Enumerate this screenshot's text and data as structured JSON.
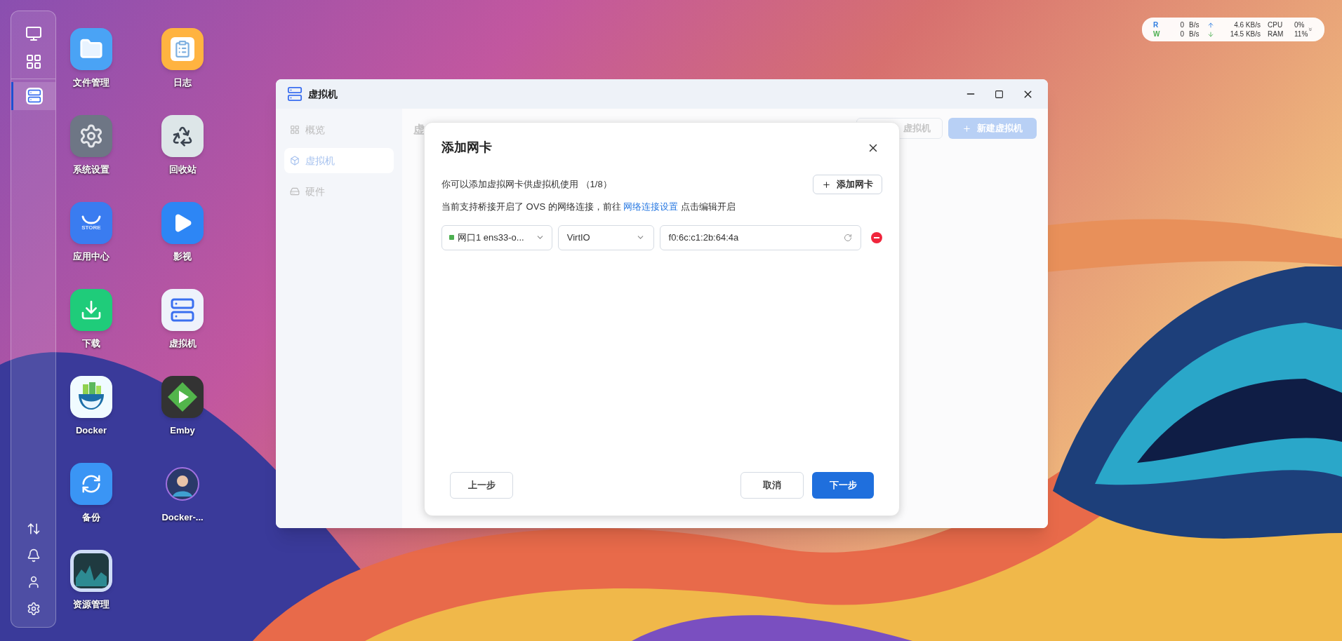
{
  "dock": {
    "apps": [
      {
        "kind": "monitor",
        "selected": false
      },
      {
        "kind": "apps",
        "selected": false
      },
      {
        "kind": "vm",
        "selected": true
      }
    ],
    "tools": [
      {
        "kind": "transfer"
      },
      {
        "kind": "bell"
      },
      {
        "kind": "user"
      },
      {
        "kind": "gear"
      }
    ]
  },
  "desktop_icons": [
    {
      "label": "文件管理",
      "kind": "files"
    },
    {
      "label": "日志",
      "kind": "notes"
    },
    {
      "label": "系统设置",
      "kind": "settings"
    },
    {
      "label": "回收站",
      "kind": "recycle"
    },
    {
      "label": "应用中心",
      "kind": "store",
      "icon_text": "STORE"
    },
    {
      "label": "影视",
      "kind": "video"
    },
    {
      "label": "下载",
      "kind": "download"
    },
    {
      "label": "虚拟机",
      "kind": "vm"
    },
    {
      "label": "Docker",
      "kind": "docker"
    },
    {
      "label": "Emby",
      "kind": "emby"
    },
    {
      "label": "备份",
      "kind": "backup"
    },
    {
      "label": "Docker-...",
      "kind": "avatar"
    },
    {
      "label": "资源管理",
      "kind": "monitor"
    }
  ],
  "status_widget": {
    "rows": [
      {
        "letter": "R",
        "color": "#2f7de1",
        "disk": "0",
        "disk_unit": "B/s",
        "kind": "upload",
        "net": "4.6 KB/s",
        "metric": "CPU",
        "percent": "0%"
      },
      {
        "letter": "W",
        "color": "#4caf50",
        "disk": "0",
        "disk_unit": "B/s",
        "kind": "download",
        "net": "14.5 KB/s",
        "metric": "RAM",
        "percent": "11%"
      }
    ]
  },
  "window": {
    "title": "虚拟机",
    "sidebar": {
      "items": [
        {
          "label": "概览",
          "kind": "overview",
          "selected": false
        },
        {
          "label": "虚拟机",
          "kind": "vm",
          "selected": true
        },
        {
          "label": "硬件",
          "kind": "hardware",
          "selected": false
        }
      ]
    },
    "header": {
      "title": "虚",
      "buttons": [
        {
          "label": "虚拟机",
          "kind": "outline"
        },
        {
          "label": "新建虚拟机",
          "kind": "primary"
        }
      ]
    }
  },
  "dialog": {
    "title": "添加网卡",
    "description": "你可以添加虚拟网卡供虚拟机使用 （1/8）",
    "add_button": "添加网卡",
    "note": {
      "before": "当前支持桥接开启了 OVS 的网络连接，前往",
      "link": "网络连接设置",
      "after": "点击编辑开启"
    },
    "nics": [
      {
        "port": "网口1 ens33-o...",
        "color": "#4caf50",
        "model": "VirtIO",
        "mac": "f0:6c:c1:2b:64:4a"
      }
    ],
    "buttons": {
      "back": "上一步",
      "cancel": "取消",
      "next": "下一步"
    }
  }
}
